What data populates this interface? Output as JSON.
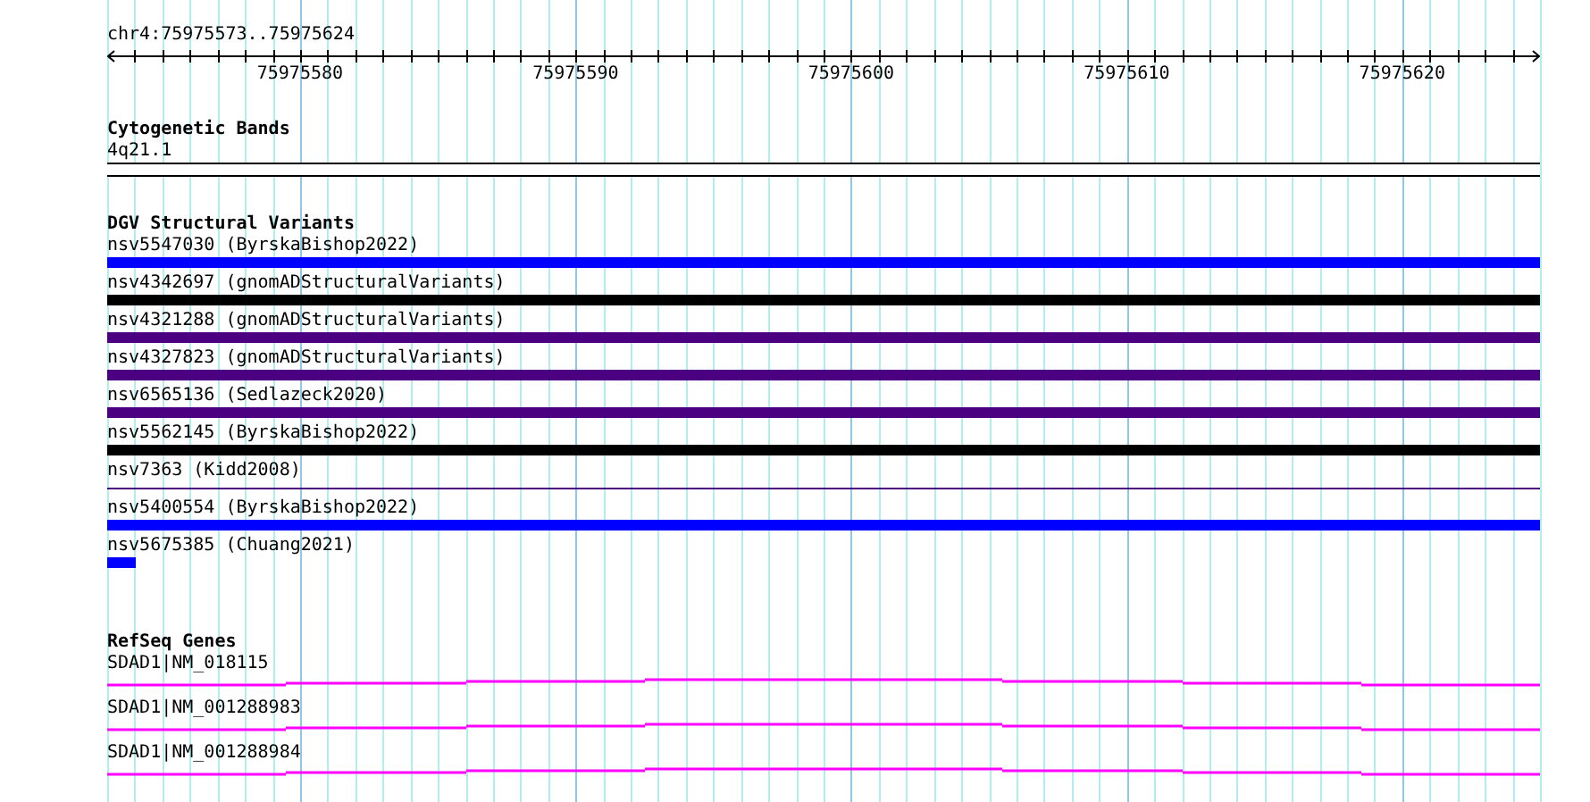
{
  "ruler": {
    "locus": "chr4:75975573..75975624",
    "ticks": [
      {
        "label": "75975580"
      },
      {
        "label": "75975590"
      },
      {
        "label": "75975600"
      },
      {
        "label": "75975610"
      },
      {
        "label": "75975620"
      }
    ]
  },
  "cytogenetic_bands": {
    "title": "Cytogenetic Bands",
    "band": "4q21.1"
  },
  "dgv": {
    "title": "DGV Structural Variants",
    "features": [
      {
        "name": "nsv5547030 (ByrskaBishop2022)",
        "color": "#0000ff",
        "kind": "bar"
      },
      {
        "name": "nsv4342697 (gnomADStructuralVariants)",
        "color": "#000000",
        "kind": "bar"
      },
      {
        "name": "nsv4321288 (gnomADStructuralVariants)",
        "color": "#4b0082",
        "kind": "bar"
      },
      {
        "name": "nsv4327823 (gnomADStructuralVariants)",
        "color": "#4b0082",
        "kind": "bar"
      },
      {
        "name": "nsv6565136 (Sedlazeck2020)",
        "color": "#4b0082",
        "kind": "bar"
      },
      {
        "name": "nsv5562145 (ByrskaBishop2022)",
        "color": "#000000",
        "kind": "bar"
      },
      {
        "name": "nsv7363 (Kidd2008)",
        "color": "#4b0082",
        "kind": "line"
      },
      {
        "name": "nsv5400554 (ByrskaBishop2022)",
        "color": "#0000ff",
        "kind": "bar"
      },
      {
        "name": "nsv5675385 (Chuang2021)",
        "color": "#0000ff",
        "kind": "short"
      }
    ]
  },
  "refseq": {
    "title": "RefSeq Genes",
    "transcripts": [
      {
        "name": "SDAD1|NM_018115"
      },
      {
        "name": "SDAD1|NM_001288983"
      },
      {
        "name": "SDAD1|NM_001288984"
      }
    ]
  }
}
